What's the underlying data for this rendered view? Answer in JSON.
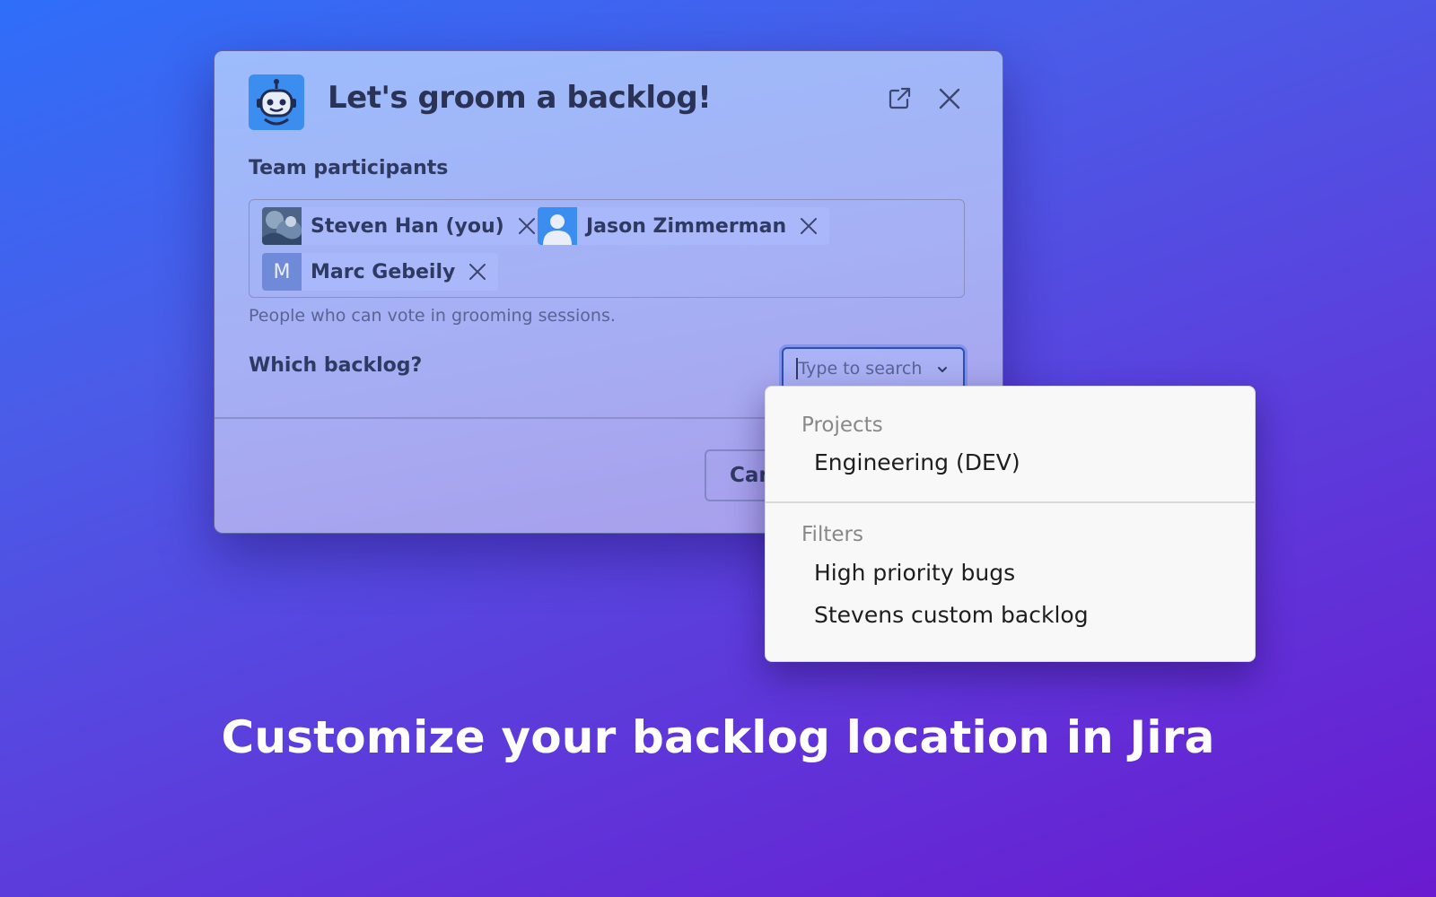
{
  "modal": {
    "title": "Let's groom a backlog!",
    "icons": {
      "bot": "robot-icon",
      "open": "external-link-icon",
      "close": "close-icon"
    },
    "participants_label": "Team participants",
    "participants": [
      {
        "name": "Steven Han (you)",
        "avatar": "photo"
      },
      {
        "name": "Jason Zimmerman",
        "avatar": "person-icon"
      },
      {
        "name": "Marc Gebeily",
        "avatar": "M"
      }
    ],
    "participants_hint": "People who can vote in grooming sessions.",
    "backlog_label": "Which backlog?",
    "search": {
      "placeholder": "Type to search"
    },
    "cancel_label": "Can"
  },
  "dropdown": {
    "groups": [
      {
        "label": "Projects",
        "items": [
          "Engineering (DEV)"
        ]
      },
      {
        "label": "Filters",
        "items": [
          "High priority bugs",
          "Stevens custom backlog"
        ]
      }
    ]
  },
  "caption": "Customize your backlog location in Jira",
  "colors": {
    "accent": "#3b8ef0",
    "background_start": "#2f6ef9",
    "background_end": "#6a1ad0"
  }
}
